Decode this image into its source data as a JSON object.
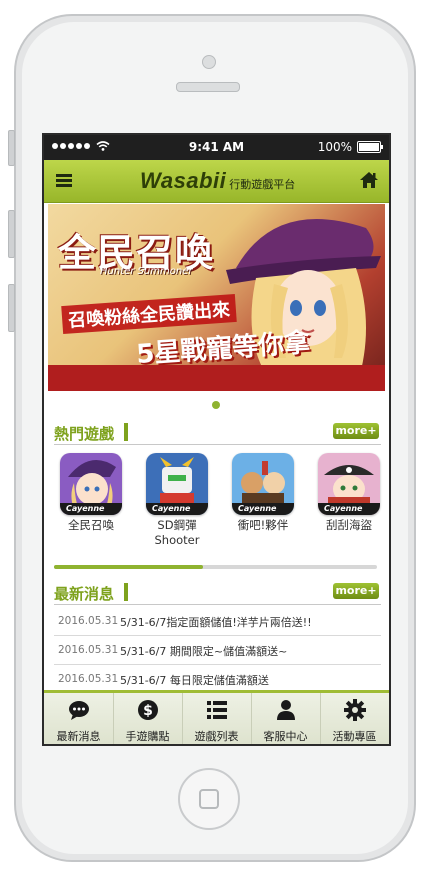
{
  "statusbar": {
    "carrier_dots": 5,
    "time": "9:41 AM",
    "battery": "100%"
  },
  "header": {
    "logo": "Wasabii",
    "subtitle": "行動遊戲平台"
  },
  "banner": {
    "title": "全民召喚",
    "subtitle": "Hunter Summoner",
    "line1": "召喚粉絲全民讚出來",
    "line2": "5星戰寵等你拿"
  },
  "hot_games": {
    "title": "熱門遊戲",
    "more_label": "more+",
    "items": [
      {
        "name": "全民召喚",
        "tag": "Cayenne"
      },
      {
        "name": "SD鋼彈 Shooter",
        "tag": "Cayenne"
      },
      {
        "name": "衝吧!夥伴",
        "tag": "Cayenne"
      },
      {
        "name": "刮刮海盜",
        "tag": "Cayenne"
      }
    ],
    "scroll_fraction": 0.46
  },
  "news": {
    "title": "最新消息",
    "more_label": "more+",
    "items": [
      {
        "date": "2016.05.31",
        "text": "5/31-6/7指定面額儲值!洋芋片兩倍送!!"
      },
      {
        "date": "2016.05.31",
        "text": "5/31-6/7 期間限定~儲值滿額送~"
      },
      {
        "date": "2016.05.31",
        "text": "5/31-6/7 每日限定儲值滿額送"
      }
    ]
  },
  "tabs": [
    {
      "label": "最新消息",
      "icon": "chat-bubble-icon"
    },
    {
      "label": "手遊購點",
      "icon": "dollar-coin-icon"
    },
    {
      "label": "遊戲列表",
      "icon": "list-icon"
    },
    {
      "label": "客服中心",
      "icon": "person-icon"
    },
    {
      "label": "活動專區",
      "icon": "gear-icon"
    }
  ],
  "colors": {
    "accent": "#8fb330",
    "navbar": "#a8c43a",
    "section_title": "#7ea21d"
  }
}
